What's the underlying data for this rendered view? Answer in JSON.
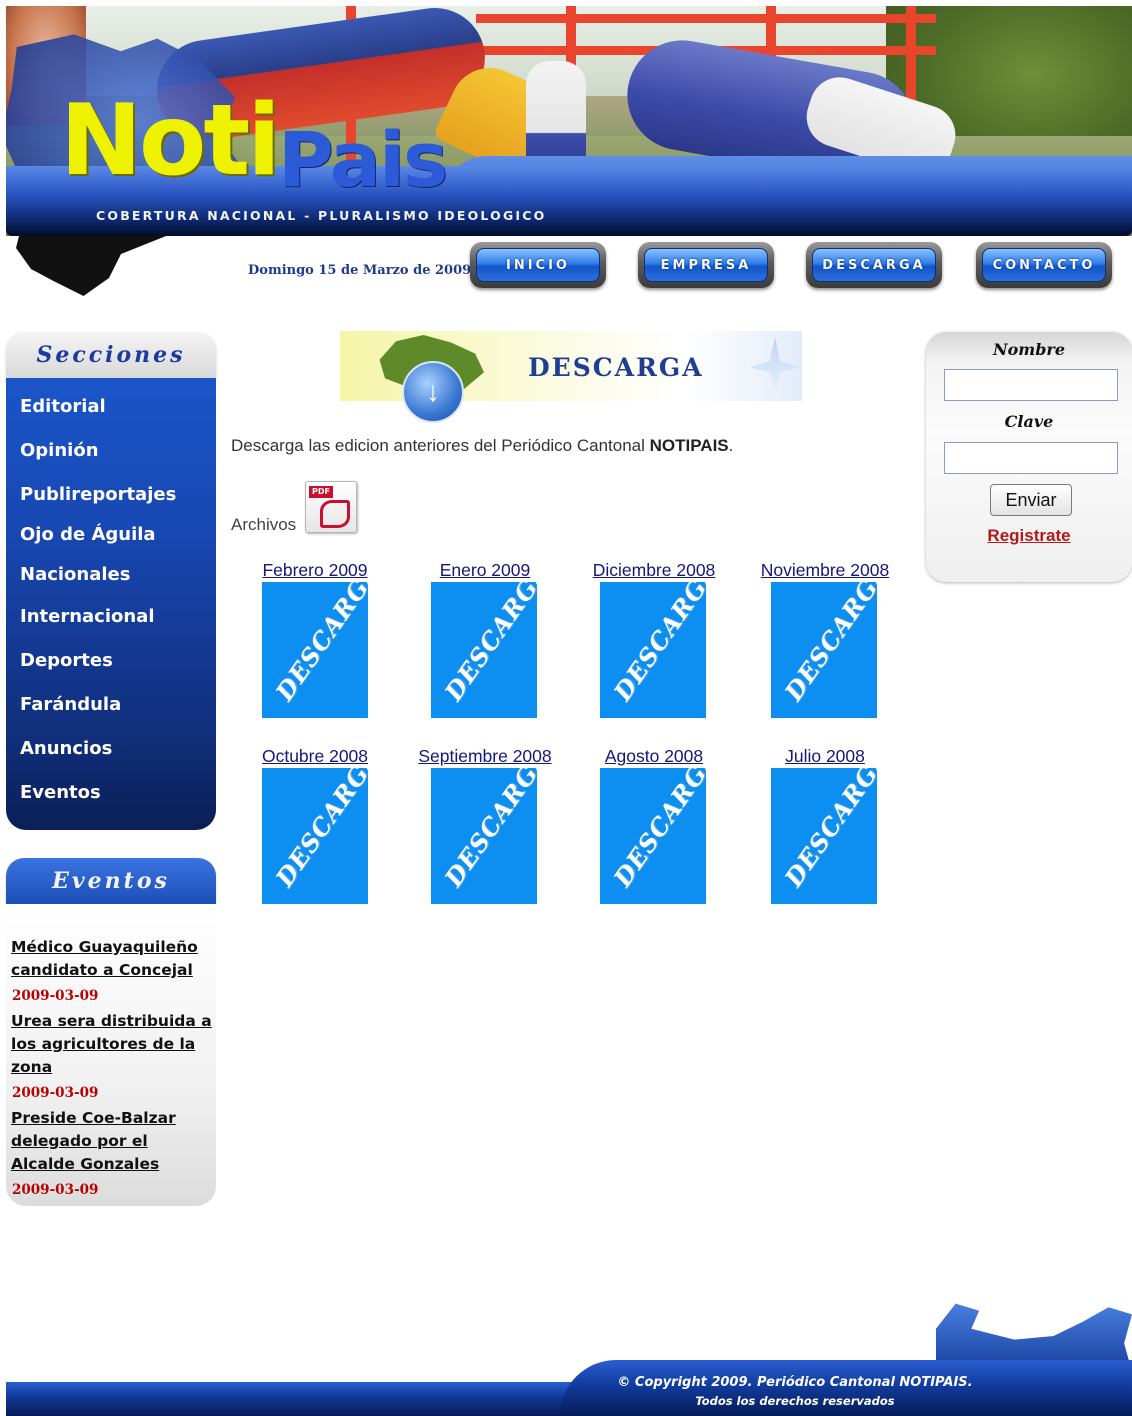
{
  "header": {
    "logo_part1": "Noti",
    "logo_part2": "Pais",
    "tagline": "COBERTURA NACIONAL - PLURALISMO IDEOLOGICO",
    "date": "Domingo 15 de Marzo de 2009",
    "nav": [
      "INICIO",
      "EMPRESA",
      "DESCARGA",
      "CONTACTO"
    ]
  },
  "sidebar": {
    "secciones_title": "Secciones",
    "sections": [
      "Editorial",
      "Opinión",
      "Publireportajes",
      "Ojo de Águila",
      "Nacionales",
      "Internacional",
      "Deportes",
      "Farándula",
      "Anuncios",
      "Eventos"
    ],
    "eventos_title": "Eventos",
    "events": [
      {
        "title": "Médico Guayaquileño candidato a Concejal",
        "date": "2009-03-09"
      },
      {
        "title": "Urea sera distribuida a los agricultores de la zona",
        "date": "2009-03-09"
      },
      {
        "title": "Preside Coe-Balzar delegado por el Alcalde Gonzales",
        "date": "2009-03-09"
      }
    ]
  },
  "main": {
    "banner_title": "DESCARGA",
    "intro_text": "Descarga las edicion anteriores del Periódico Cantonal ",
    "intro_bold": "NOTIPAIS",
    "intro_end": ".",
    "archivos_label": "Archivos",
    "pdf_tag": "PDF",
    "thumb_text": "DESCARGA",
    "archives": [
      "Febrero 2009",
      "Enero 2009",
      "Diciembre 2008",
      "Noviembre 2008",
      "Octubre 2008",
      "Septiembre 2008",
      "Agosto 2008",
      "Julio 2008"
    ]
  },
  "login": {
    "name_label": "Nombre",
    "name_value": "",
    "password_label": "Clave",
    "password_value": "",
    "submit": "Enviar",
    "register": "Registrate"
  },
  "footer": {
    "line1": "© Copyright 2009. Periódico Cantonal NOTIPAIS.",
    "line2": "Todos los derechos reservados"
  },
  "colors": {
    "nav_blue": "#1456c7",
    "sidebar_blue": "#1847b1",
    "event_date_red": "#b80000",
    "thumb_blue": "#0d8ff1",
    "logo_yellow": "#eef200"
  }
}
